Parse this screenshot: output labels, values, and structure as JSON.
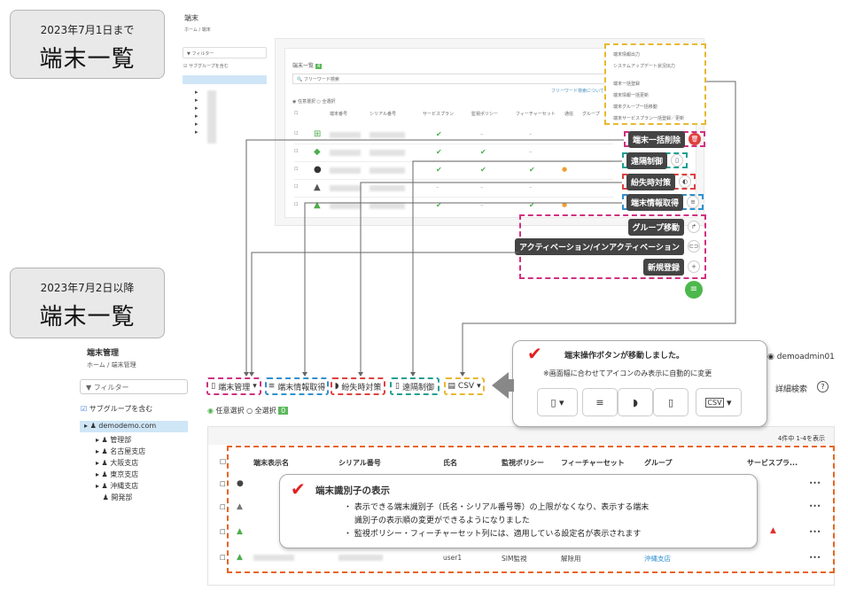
{
  "old_section": {
    "date": "2023年7月1日まで",
    "title": "端末一覧",
    "app_title": "端末",
    "breadcrumb": "ホーム / 端末",
    "filter": "フィルター",
    "subgroup": "サブグループを含む",
    "card_title": "端末一覧",
    "search_placeholder": "フリーワード検索",
    "search_help": "フリーワード検索について",
    "select_any": "任意選択",
    "select_all": "全選択",
    "columns": [
      "端末番号",
      "シリアル番号",
      "サービスプラン",
      "監視ポリシー",
      "フィーチャーセット",
      "通信",
      "グループ"
    ],
    "menu_items": [
      "端末情報出力",
      "システムアップデート状況出力",
      "端末一括登録",
      "端末情報一括更新",
      "端末グループ一括移動",
      "端末サービスプラン一括登録／更新"
    ],
    "action_labels": [
      "端末一括削除",
      "遠隔制御",
      "紛失時対策",
      "端末情報取得",
      "グループ移動",
      "アクティベーション/インアクティベーション",
      "新規登録"
    ]
  },
  "new_section": {
    "date": "2023年7月2日以降",
    "title": "端末一覧",
    "app_title": "端末管理",
    "breadcrumb": "ホーム / 端末管理",
    "user": "demoadmin01",
    "filter": "フィルター",
    "subgroup": "サブグループを含む",
    "select_any": "任意選択",
    "select_all": "全選択",
    "select_count": "0",
    "toolbar": {
      "device_mgmt": "端末管理",
      "info_get": "端末情報取得",
      "lost": "紛失時対策",
      "remote": "遠隔制御",
      "csv": "CSV",
      "detail_search": "詳細検索"
    },
    "tree_root": "demodemo.com",
    "tree": [
      "管理部",
      "名古屋支店",
      "大阪支店",
      "東京支店",
      "沖縄支店",
      "開発部"
    ],
    "count": "4件中 1-4を表示",
    "columns": [
      "端末表示名",
      "シリアル番号",
      "氏名",
      "監視ポリシー",
      "フィーチャーセット",
      "グループ",
      "サービスプラ..."
    ],
    "last_row": {
      "name": "user1",
      "policy": "SIM監視",
      "feature": "解除用",
      "group": "沖縄支店"
    }
  },
  "callout_move": {
    "title": "端末操作ボタンが移動しました。",
    "note": "※画面幅に合わせてアイコンのみ表示に自動的に変更",
    "icon_csv": "CSV"
  },
  "callout_id": {
    "title": "端末識別子の表示",
    "bullet1a": "表示できる端末識別子（氏名・シリアル番号等）の上限がなくなり、表示する端末",
    "bullet1b": "識別子の表示順の変更ができるようになりました",
    "bullet2": "監視ポリシー・フィーチャーセット列には、適用している設定名が表示されます"
  }
}
